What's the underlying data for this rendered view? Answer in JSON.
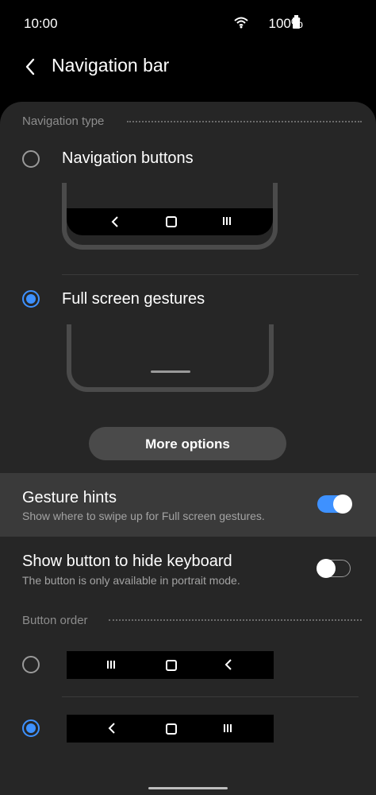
{
  "status": {
    "time": "10:00",
    "battery": "100%"
  },
  "header": {
    "title": "Navigation bar"
  },
  "navigation_type": {
    "header": "Navigation type",
    "options": [
      {
        "label": "Navigation buttons",
        "selected": false
      },
      {
        "label": "Full screen gestures",
        "selected": true
      }
    ]
  },
  "more_options": {
    "label": "More options"
  },
  "gesture_hints": {
    "title": "Gesture hints",
    "subtitle": "Show where to swipe up for Full screen gestures.",
    "enabled": true
  },
  "hide_keyboard": {
    "title": "Show button to hide keyboard",
    "subtitle": "The button is only available in portrait mode.",
    "enabled": false
  },
  "button_order": {
    "header": "Button order",
    "options": [
      {
        "order": [
          "recents",
          "home",
          "back"
        ],
        "selected": false
      },
      {
        "order": [
          "back",
          "home",
          "recents"
        ],
        "selected": true
      }
    ]
  },
  "colors": {
    "accent": "#3e91ff",
    "panel": "#262626",
    "background": "#000000",
    "highlight_row": "#3a3a3a"
  }
}
